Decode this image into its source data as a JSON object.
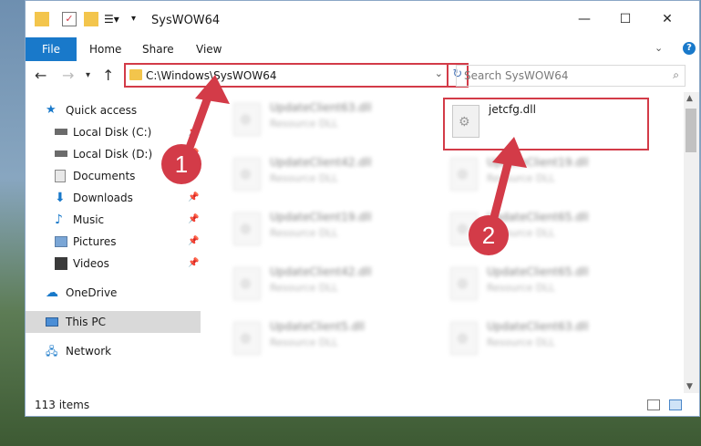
{
  "window": {
    "title": "SysWOW64"
  },
  "ribbon": {
    "file": "File",
    "tabs": [
      "Home",
      "Share",
      "View"
    ]
  },
  "address": {
    "path": "C:\\Windows\\SysWOW64"
  },
  "search": {
    "placeholder": "Search SysWOW64"
  },
  "nav": {
    "items": [
      {
        "label": "Quick access"
      },
      {
        "label": "Local Disk (C:)"
      },
      {
        "label": "Local Disk (D:)"
      },
      {
        "label": "Documents"
      },
      {
        "label": "Downloads"
      },
      {
        "label": "Music"
      },
      {
        "label": "Pictures"
      },
      {
        "label": "Videos"
      },
      {
        "label": "OneDrive"
      },
      {
        "label": "This PC"
      },
      {
        "label": "Network"
      }
    ]
  },
  "files": [
    {
      "name": "UpdateClient63.dll",
      "type": "Resource DLL"
    },
    {
      "name": "jetcfg.dll",
      "type": ""
    },
    {
      "name": "UpdateClient42.dll",
      "type": "Resource DLL"
    },
    {
      "name": "UpdateClient19.dll",
      "type": "Resource DLL"
    },
    {
      "name": "UpdateClient19.dll",
      "type": "Resource DLL"
    },
    {
      "name": "UpdateClient65.dll",
      "type": "Resource DLL"
    },
    {
      "name": "UpdateClient42.dll",
      "type": "Resource DLL"
    },
    {
      "name": "UpdateClient65.dll",
      "type": "Resource DLL"
    },
    {
      "name": "UpdateClient5.dll",
      "type": "Resource DLL"
    },
    {
      "name": "UpdateClient63.dll",
      "type": "Resource DLL"
    }
  ],
  "status": {
    "count": "113 items"
  },
  "annotations": {
    "step1": "1",
    "step2": "2"
  },
  "colors": {
    "accent": "#1979ca",
    "highlight": "#d33b48"
  }
}
